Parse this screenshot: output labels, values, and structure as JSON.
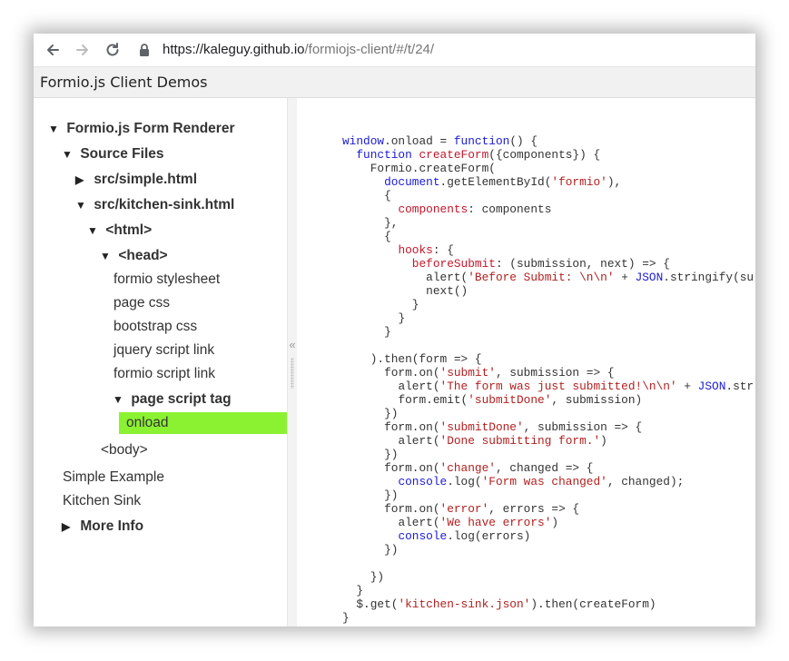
{
  "browser": {
    "url_host": "https://kaleguy.github.io",
    "url_path": "/formiojs-client/#/t/24/"
  },
  "app": {
    "title": "Formio.js Client Demos"
  },
  "icons": {
    "back": "arrow-left-icon",
    "forward": "arrow-right-icon",
    "reload": "reload-icon",
    "lock": "lock-icon",
    "collapse": "double-chevron-left-icon",
    "expanded": "triangle-down-icon",
    "collapsed": "triangle-right-icon"
  },
  "tree": {
    "root": "Formio.js Form Renderer",
    "source_files": "Source Files",
    "simple_html": "src/simple.html",
    "kitchen_sink_html": "src/kitchen-sink.html",
    "html": "<html>",
    "head": "<head>",
    "formio_stylesheet": "formio stylesheet",
    "page_css": "page css",
    "bootstrap_css": "bootstrap css",
    "jquery_script_link": "jquery script link",
    "formio_script_link": "formio script link",
    "page_script_tag": "page script tag",
    "onload": "onload",
    "body": "<body>",
    "simple_example": "Simple Example",
    "kitchen_sink": "Kitchen Sink",
    "more_info": "More Info"
  },
  "colors": {
    "selected": "#8bf232",
    "keyword": "#1a1ad6",
    "string": "#b21f1f"
  },
  "code": {
    "w1": "window",
    "w2": ".onload = ",
    "w3": "function",
    "w4": "() {",
    "f1": "function",
    "f2": "createForm",
    "f3": "({components}) {",
    "l3": "Formio.createForm(",
    "d1": "document",
    "d2": ".getElementById(",
    "d3": "'formio'",
    "d4": "),",
    "l5": "{",
    "c1": "components",
    "c2": ": components",
    "l7": "},",
    "l8": "{",
    "h1": "hooks",
    "h2": ": {",
    "b1": "beforeSubmit",
    "b2": ": (submission, next) => {",
    "a1": "alert(",
    "a2": "'Before Submit: \\n\\n'",
    "a3": " + ",
    "a4": "JSON",
    "a5": ".stringify(su",
    "l12": "next()",
    "l13": "}",
    "l14": "}",
    "l15": "}",
    "t1": ").then(form => {",
    "o1": "form.on(",
    "o2": "'submit'",
    "o3": ", submission => {",
    "a6": "alert(",
    "a7": "'The form was just submitted!\\n\\n'",
    "a8": " + ",
    "a9": "JSON",
    "a10": ".str",
    "e1": "form.emit(",
    "e2": "'submitDone'",
    "e3": ", submission)",
    "l21": "})",
    "o4": "form.on(",
    "o5": "'submitDone'",
    "o6": ", submission => {",
    "a11": "alert(",
    "a12": "'Done submitting form.'",
    "a13": ")",
    "l24": "})",
    "o7": "form.on(",
    "o8": "'change'",
    "o9": ", changed => {",
    "cl1": "console",
    "cl2": ".log(",
    "cl3": "'Form was changed'",
    "cl4": ", changed);",
    "l27": "})",
    "o10": "form.on(",
    "o11": "'error'",
    "o12": ", errors => {",
    "a14": "alert(",
    "a15": "'We have errors'",
    "a16": ")",
    "cl5": "console",
    "cl6": ".log(errors)",
    "l31": "})",
    "l33": "})",
    "l34": "}",
    "g1": "$.get(",
    "g2": "'kitchen-sink.json'",
    "g3": ").then(createForm)",
    "l36": "}"
  }
}
